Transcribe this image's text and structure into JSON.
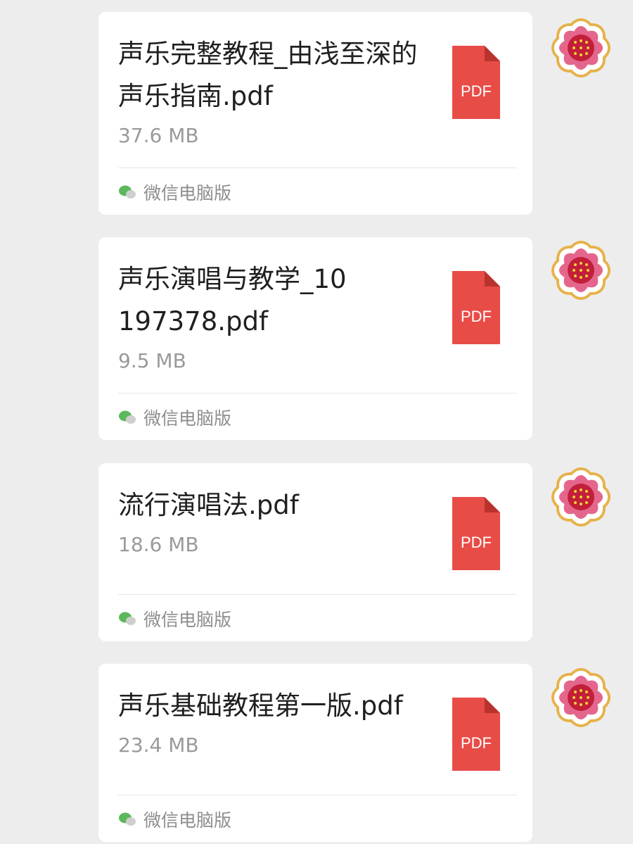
{
  "files": [
    {
      "name": "声乐完整教程_由浅至深的声乐指南.pdf",
      "size": "37.6 MB",
      "source": "微信电脑版",
      "type_badge": "PDF"
    },
    {
      "name": "声乐演唱与教学_10197378.pdf",
      "size": "9.5 MB",
      "source": "微信电脑版",
      "type_badge": "PDF"
    },
    {
      "name": "流行演唱法.pdf",
      "size": "18.6 MB",
      "source": "微信电脑版",
      "type_badge": "PDF"
    },
    {
      "name": "声乐基础教程第一版.pdf",
      "size": "23.4 MB",
      "source": "微信电脑版",
      "type_badge": "PDF"
    }
  ],
  "icons": {
    "file_type": "pdf-file-icon",
    "source": "wechat-icon",
    "decoration": "flower-sticker"
  },
  "colors": {
    "background": "#ededed",
    "card": "#ffffff",
    "pdf_red": "#e84c47",
    "source_green": "#5cb85c",
    "flower_petal": "#e4668c",
    "flower_center": "#c21f3a"
  }
}
